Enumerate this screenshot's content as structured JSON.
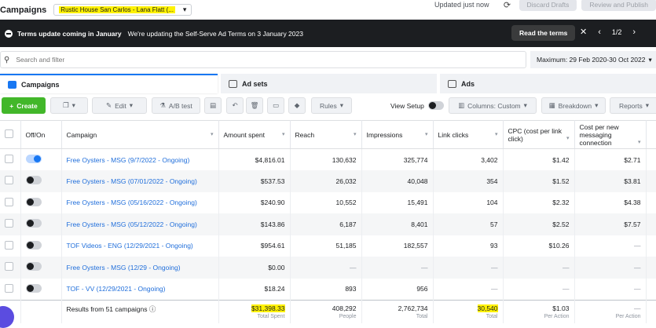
{
  "topbar": {
    "title": "Campaigns",
    "account": "Rustic House San Carlos - Lana Flatt (...",
    "updated": "Updated just now",
    "discard_drafts": "Discard Drafts",
    "review_publish": "Review and Publish"
  },
  "banner": {
    "title": "Terms update coming in January",
    "text": "We're updating the Self-Serve Ad Terms on 3 January 2023",
    "read_terms": "Read the terms",
    "pager": "1/2"
  },
  "search": {
    "placeholder": "Search and filter",
    "date_range": "Maximum: 29 Feb 2020-30 Oct 2022"
  },
  "tabs": [
    "Campaigns",
    "Ad sets",
    "Ads"
  ],
  "toolbar": {
    "create": "Create",
    "edit": "Edit",
    "ab_test": "A/B test",
    "rules": "Rules",
    "view_setup": "View Setup",
    "columns": "Columns: Custom",
    "breakdown": "Breakdown",
    "reports": "Reports"
  },
  "table": {
    "headers": {
      "offon": "Off/On",
      "campaign": "Campaign",
      "amount_spent": "Amount spent",
      "reach": "Reach",
      "impressions": "Impressions",
      "link_clicks": "Link clicks",
      "cpc": "CPC (cost per link click)",
      "cost_per_msg": "Cost per new messaging connection"
    },
    "rows": [
      {
        "on": true,
        "campaign": "Free Oysters - MSG (9/7/2022 - Ongoing)",
        "spent": "$4,816.01",
        "reach": "130,632",
        "impressions": "325,774",
        "clicks": "3,402",
        "cpc": "$1.42",
        "cpm": "$2.71"
      },
      {
        "on": false,
        "campaign": "Free Oysters - MSG (07/01/2022 - Ongoing)",
        "spent": "$537.53",
        "reach": "26,032",
        "impressions": "40,048",
        "clicks": "354",
        "cpc": "$1.52",
        "cpm": "$3.81"
      },
      {
        "on": false,
        "campaign": "Free Oysters - MSG (05/16/2022 - Ongoing)",
        "spent": "$240.90",
        "reach": "10,552",
        "impressions": "15,491",
        "clicks": "104",
        "cpc": "$2.32",
        "cpm": "$4.38"
      },
      {
        "on": false,
        "campaign": "Free Oysters - MSG (05/12/2022 - Ongoing)",
        "spent": "$143.86",
        "reach": "6,187",
        "impressions": "8,401",
        "clicks": "57",
        "cpc": "$2.52",
        "cpm": "$7.57"
      },
      {
        "on": false,
        "campaign": "TOF Videos - ENG (12/29/2021 - Ongoing)",
        "spent": "$954.61",
        "reach": "51,185",
        "impressions": "182,557",
        "clicks": "93",
        "cpc": "$10.26",
        "cpm": "—"
      },
      {
        "on": false,
        "campaign": "Free Oysters - MSG (12/29 - Ongoing)",
        "spent": "$0.00",
        "reach": "—",
        "impressions": "—",
        "clicks": "—",
        "cpc": "—",
        "cpm": "—"
      },
      {
        "on": false,
        "campaign": "TOF - VV (12/29/2021 - Ongoing)",
        "spent": "$18.24",
        "reach": "893",
        "impressions": "956",
        "clicks": "—",
        "cpc": "—",
        "cpm": "—"
      }
    ],
    "footer": {
      "label": "Results from 51 campaigns",
      "spent": "$31,398.33",
      "spent_sub": "Total Spent",
      "reach": "408,292",
      "reach_sub": "People",
      "impressions": "2,762,734",
      "impressions_sub": "Total",
      "clicks": "30,540",
      "clicks_sub": "Total",
      "cpc": "$1.03",
      "cpc_sub": "Per Action",
      "cpm": "—",
      "cpm_sub": "Per Action"
    }
  },
  "colors": {
    "accent": "#1877f2",
    "create": "#42b72a",
    "highlight": "#fff200",
    "link": "#216fdb"
  }
}
